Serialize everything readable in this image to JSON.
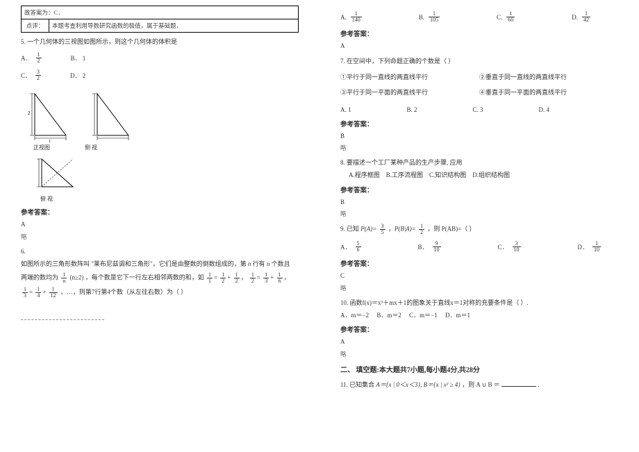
{
  "leftCol": {
    "boxRow1": "故答案为：C．",
    "boxRow2Label": "点评：",
    "boxRow2Text": "本题考查利用导数研究函数的极值，属于基础题．",
    "q5_stem": "5. 一个几何体的三视图如图所示，则这个几何体的体积是",
    "q5_optA": "A．",
    "q5_optA_num": "1",
    "q5_optA_den": "2",
    "q5_optB": "B．  1",
    "q5_optC": "C．",
    "q5_optC_num": "3",
    "q5_optC_den": "2",
    "q5_optD": "D．  2",
    "view_front": "正视图",
    "view_side": "侧  视",
    "view_top": "俯  视",
    "ref_label": "参考答案：",
    "q5_ans": "A",
    "lue": "略",
    "q6_num": "6.",
    "q6_line1_a": "如图所示的三角形数阵叫 \"莱布尼兹调和三角形\"，它们是由整数的倒数组成的，第",
    "q6_line1_b": "行有",
    "q6_line1_c": "个数且",
    "q6_line2_a": "两端的数均为",
    "q6_line2_b": "，每个数是它下一行左右相邻两数的和，如",
    "q6_f1n": "1",
    "q6_f1d": "n",
    "q6_cond": "(n≥2)",
    "q6_f2an": "1",
    "q6_f2ad": "1",
    "q6_f2bn": "1",
    "q6_f2bd": "2",
    "q6_f2cn": "1",
    "q6_f2cd": "2",
    "q6_f3an": "1",
    "q6_f3ad": "2",
    "q6_f3bn": "1",
    "q6_f3bd": "3",
    "q6_f3cn": "1",
    "q6_f3cd": "6",
    "q6_f4an": "1",
    "q6_f4ad": "3",
    "q6_f4bn": "1",
    "q6_f4bd": "4",
    "q6_f4cn": "1",
    "q6_f4cd": "12",
    "q6_line3": "，…，则第7行第4个数（从左往右数）为（  ）"
  },
  "rightCol": {
    "q6_optA": "A.",
    "q6_optA_n": "1",
    "q6_optA_d": "140",
    "q6_optB": "B.",
    "q6_optB_n": "1",
    "q6_optB_d": "105",
    "q6_optC": "C.",
    "q6_optC_n": "1",
    "q6_optC_d": "60",
    "q6_optD": "D.",
    "q6_optD_n": "1",
    "q6_optD_d": "42",
    "ref_label": "参考答案：",
    "q6_ans": "A",
    "q7_stem": "7. 在空间中，下列命题正确的个数是（    ）",
    "q7_1": "①平行于同一直线的两直线平行",
    "q7_2": "②垂直于同一直线的两直线平行",
    "q7_3": "③平行于同一平面的两直线平行",
    "q7_4": "④垂直于同一平面的两直线平行",
    "q7_A": "A. 1",
    "q7_B": "B. 2",
    "q7_C": "C. 3",
    "q7_D": "D. 4",
    "q7_ans": "B",
    "lue": "略",
    "q8_stem": "8. 要描述一个工厂某种产品的生产步骤, 应用",
    "q8_A": "A.程序框图",
    "q8_B": "B.工序流程图",
    "q8_C": "C.知识结构图",
    "q8_D": "D.组织结构图",
    "q8_ans": "B",
    "q9_stem_a": "9. 已知",
    "q9_PA": "P(A)=",
    "q9_PA_n": "3",
    "q9_PA_d": "5",
    "q9_PBA": "，P(B|A)=",
    "q9_PBA_n": "1",
    "q9_PBA_d": "2",
    "q9_then": "，则 P(AB)=（    ）",
    "q9_A": "A．",
    "q9_A_n": "5",
    "q9_A_d": "6",
    "q9_B": "B．",
    "q9_B_n": "9",
    "q9_B_d": "10",
    "q9_C": "C．",
    "q9_C_n": "3",
    "q9_C_d": "10",
    "q9_D": "D．",
    "q9_D_n": "1",
    "q9_D_d": "10",
    "q9_ans": "C",
    "q10_stem": "10. 函数f(x)＝x³＋mx＋1的图象关于直线x＝1对称的充要条件是（    ）.",
    "q10_A": "A．m＝−2",
    "q10_B": "B．m＝2",
    "q10_C": "C．m＝−1",
    "q10_D": "D．m＝1",
    "q10_ans": "A",
    "sec2": "二、 填空题:本大题共7小题,每小题4分,共28分",
    "q11_stem_a": "11. 已知集合",
    "q11_setA": "A＝{x | 0＜x＜3}, B＝{x | x² ≥ 4}",
    "q11_then": "，则 A ∪ B ＝",
    "q11_end": "."
  }
}
